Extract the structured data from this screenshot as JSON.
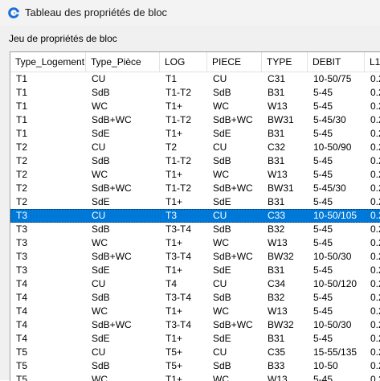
{
  "window": {
    "title": "Tableau des propriétés de bloc",
    "app_icon": "gstarcad-logo-icon"
  },
  "group_label": "Jeu de propriétés de bloc",
  "table": {
    "columns": [
      "Type_Logement",
      "Type_Pièce",
      "LOG",
      "PIECE",
      "TYPE",
      "DEBIT",
      "L1"
    ],
    "selected_row_index": 10,
    "selection_color": "#0078d7",
    "rows": [
      [
        "T1",
        "CU",
        "T1",
        "CU",
        "C31",
        "10-50/75",
        "0.2"
      ],
      [
        "T1",
        "SdB",
        "T1-T2",
        "SdB",
        "B31",
        "5-45",
        "0.2"
      ],
      [
        "T1",
        "WC",
        "T1+",
        "WC",
        "W13",
        "5-45",
        "0.2"
      ],
      [
        "T1",
        "SdB+WC",
        "T1-T2",
        "SdB+WC",
        "BW31",
        "5-45/30",
        "0.2"
      ],
      [
        "T1",
        "SdE",
        "T1+",
        "SdE",
        "B31",
        "5-45",
        "0.2"
      ],
      [
        "T2",
        "CU",
        "T2",
        "CU",
        "C32",
        "10-50/90",
        "0.2"
      ],
      [
        "T2",
        "SdB",
        "T1-T2",
        "SdB",
        "B31",
        "5-45",
        "0.2"
      ],
      [
        "T2",
        "WC",
        "T1+",
        "WC",
        "W13",
        "5-45",
        "0.2"
      ],
      [
        "T2",
        "SdB+WC",
        "T1-T2",
        "SdB+WC",
        "BW31",
        "5-45/30",
        "0.2"
      ],
      [
        "T2",
        "SdE",
        "T1+",
        "SdE",
        "B31",
        "5-45",
        "0.2"
      ],
      [
        "T3",
        "CU",
        "T3",
        "CU",
        "C33",
        "10-50/105",
        "0.2"
      ],
      [
        "T3",
        "SdB",
        "T3-T4",
        "SdB",
        "B32",
        "5-45",
        "0.2"
      ],
      [
        "T3",
        "WC",
        "T1+",
        "WC",
        "W13",
        "5-45",
        "0.2"
      ],
      [
        "T3",
        "SdB+WC",
        "T3-T4",
        "SdB+WC",
        "BW32",
        "10-50/30",
        "0.2"
      ],
      [
        "T3",
        "SdE",
        "T1+",
        "SdE",
        "B31",
        "5-45",
        "0.2"
      ],
      [
        "T4",
        "CU",
        "T4",
        "CU",
        "C34",
        "10-50/120",
        "0.2"
      ],
      [
        "T4",
        "SdB",
        "T3-T4",
        "SdB",
        "B32",
        "5-45",
        "0.2"
      ],
      [
        "T4",
        "WC",
        "T1+",
        "WC",
        "W13",
        "5-45",
        "0.2"
      ],
      [
        "T4",
        "SdB+WC",
        "T3-T4",
        "SdB+WC",
        "BW32",
        "10-50/30",
        "0.2"
      ],
      [
        "T4",
        "SdE",
        "T1+",
        "SdE",
        "B31",
        "5-45",
        "0.2"
      ],
      [
        "T5",
        "CU",
        "T5+",
        "CU",
        "C35",
        "15-55/135",
        "0.2"
      ],
      [
        "T5",
        "SdB",
        "T5+",
        "SdB",
        "B33",
        "10-50",
        "0.2"
      ],
      [
        "T5",
        "WC",
        "T1+",
        "WC",
        "W13",
        "5-45",
        "0.2"
      ]
    ]
  }
}
